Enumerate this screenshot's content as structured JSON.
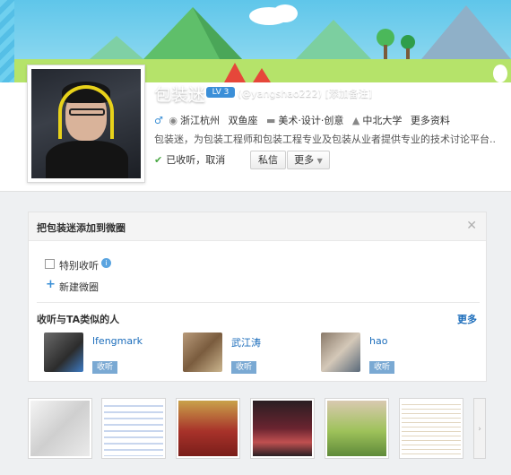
{
  "profile": {
    "name": "包装迷",
    "level": "LV 3",
    "handle": "(@yangshao222) [添加备注]",
    "gender_icon": "male-icon",
    "location": "浙江杭州",
    "zodiac": "双鱼座",
    "industry": "美术·设计·创意",
    "school": "中北大学",
    "more_info": "更多资料",
    "description": "包装迷，为包装工程师和包装工程专业及包装从业者提供专业的技术讨论平台...",
    "followed_status": "已收听",
    "unfollow": "取消",
    "message_button": "私信",
    "more_button": "更多"
  },
  "group_panel": {
    "title": "把包装迷添加到微圈",
    "close_icon": "close-icon",
    "special_follow": "特别收听",
    "new_group": "新建微圈",
    "similar_title": "收听与TA类似的人",
    "more_link": "更多",
    "similar_users": [
      {
        "name": "lfengmark",
        "action": "收听"
      },
      {
        "name": "武江涛",
        "action": "收听"
      },
      {
        "name": "hao",
        "action": "收听"
      }
    ]
  },
  "photos": {
    "count_visible": 6,
    "scroll_icon": "scroll-right-icon"
  }
}
